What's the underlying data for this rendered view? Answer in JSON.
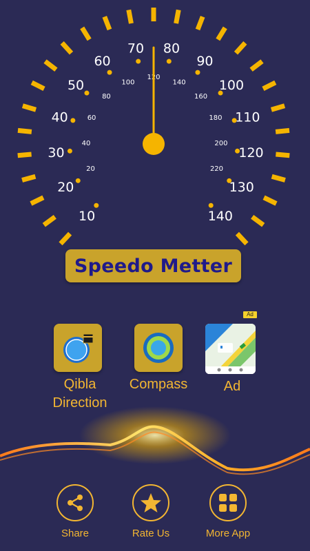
{
  "gauge": {
    "outer_labels": [
      "10",
      "20",
      "30",
      "40",
      "50",
      "60",
      "70",
      "80",
      "90",
      "100",
      "110",
      "120",
      "130",
      "140"
    ],
    "inner_labels": [
      "20",
      "40",
      "60",
      "80",
      "100",
      "120",
      "140",
      "160",
      "180",
      "200",
      "220"
    ],
    "needle_value": 75,
    "min": 10,
    "max": 140,
    "accent_color": "#f5b400"
  },
  "title": {
    "label": "Speedo Metter"
  },
  "apps": [
    {
      "label": "Qibla\nDirection",
      "icon": "qibla-compass-icon"
    },
    {
      "label": "Compass",
      "icon": "compass-icon"
    },
    {
      "label": "Ad",
      "icon": "map-navigation-icon",
      "badge": "Ad"
    }
  ],
  "bottom_nav": {
    "share": {
      "label": "Share",
      "icon": "share-icon"
    },
    "rate": {
      "label": "Rate Us",
      "icon": "star-icon"
    },
    "more": {
      "label": "More App",
      "icon": "grid-icon"
    }
  },
  "colors": {
    "background": "#2b2a55",
    "gold": "#c9a32b",
    "orange": "#f3b632"
  }
}
